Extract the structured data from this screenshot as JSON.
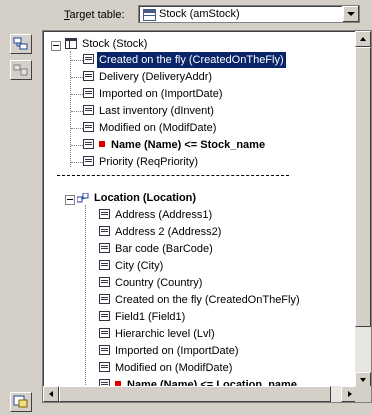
{
  "target": {
    "label_underlined": "T",
    "label_rest": "arget table:",
    "value": "Stock (amStock)"
  },
  "tree": {
    "root": "Stock (Stock)",
    "stock_fields": [
      {
        "label": "Created on the fly (CreatedOnTheFly)",
        "selected": true
      },
      {
        "label": "Delivery (DeliveryAddr)"
      },
      {
        "label": "Imported on (ImportDate)"
      },
      {
        "label": "Last inventory (dInvent)"
      },
      {
        "label": "Modified on (ModifDate)"
      },
      {
        "label": "Name (Name)  <=  Stock_name",
        "mapped": true
      },
      {
        "label": "Priority (ReqPriority)"
      }
    ],
    "link_node": "Location (Location)",
    "location_fields": [
      {
        "label": "Address (Address1)"
      },
      {
        "label": "Address 2 (Address2)"
      },
      {
        "label": "Bar code (BarCode)"
      },
      {
        "label": "City (City)"
      },
      {
        "label": "Country (Country)"
      },
      {
        "label": "Created on the fly (CreatedOnTheFly)"
      },
      {
        "label": "Field1 (Field1)"
      },
      {
        "label": "Hierarchic level (Lvl)"
      },
      {
        "label": "Imported on (ImportDate)"
      },
      {
        "label": "Modified on (ModifDate)"
      },
      {
        "label": "Name (Name)  <=  Location_name",
        "mapped": true
      }
    ]
  },
  "colors": {
    "selection": "#0a246a",
    "mapped_marker": "#e00000"
  }
}
